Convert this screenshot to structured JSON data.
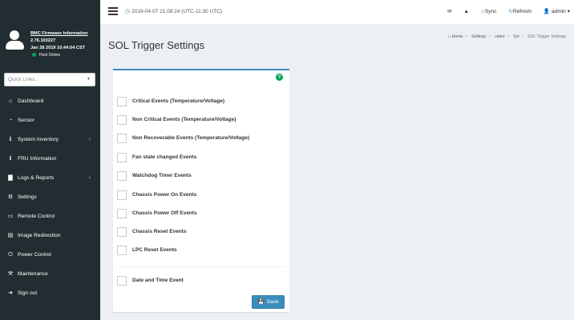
{
  "sidebar": {
    "user": {
      "fw_link": "BMC Firmware Information",
      "version": "2.76.103227",
      "build_date": "Jan 28 2019 10:44:04 CST",
      "status": "Host Online"
    },
    "quicklinks_placeholder": "Quick Links..",
    "items": [
      {
        "label": "Dashboard",
        "icon": "dashboard-icon",
        "glyph": "⌂"
      },
      {
        "label": "Sensor",
        "icon": "sensor-icon",
        "glyph": "◔"
      },
      {
        "label": "System Inventory",
        "icon": "info-icon",
        "glyph": "ℹ",
        "has_submenu": true
      },
      {
        "label": "FRU Information",
        "icon": "info-icon",
        "glyph": "ℹ"
      },
      {
        "label": "Logs & Reports",
        "icon": "chart-icon",
        "glyph": "▇",
        "has_submenu": true
      },
      {
        "label": "Settings",
        "icon": "gear-icon",
        "glyph": "⚙"
      },
      {
        "label": "Remote Control",
        "icon": "monitor-icon",
        "glyph": "▭"
      },
      {
        "label": "Image Redirection",
        "icon": "drive-icon",
        "glyph": "▤"
      },
      {
        "label": "Power Control",
        "icon": "power-icon",
        "glyph": "⏻"
      },
      {
        "label": "Maintenance",
        "icon": "wrench-icon",
        "glyph": "⚒"
      },
      {
        "label": "Sign out",
        "icon": "sign-out-icon",
        "glyph": "➜"
      }
    ]
  },
  "topbar": {
    "datetime": "2019-04-07 21:08:24 (UTC-11:30 UTC)",
    "sync_label": "Sync",
    "refresh_label": "Refresh",
    "user_label": "admin"
  },
  "header": {
    "title": "SOL Trigger Settings",
    "breadcrumb": [
      "Home",
      "Settings",
      "video",
      "Sol",
      "SOL Trigger Settings"
    ]
  },
  "form": {
    "events": [
      "Critical Events (Temperature/Voltage)",
      "Non Critical Events (Temperature/Voltage)",
      "Non Recoverable Events (Temperature/Voltage)",
      "Fan state changed Events",
      "Watchdog Timer Events",
      "Chassis Power On Events",
      "Chassis Power Off Events",
      "Chassis Reset Events",
      "LPC Reset Events"
    ],
    "date_time_event": "Date and Time Event",
    "save_label": "Save"
  },
  "colors": {
    "sidebar_bg": "#222d32",
    "accent": "#3c8dbc",
    "online": "#00a65a",
    "content_bg": "#ecf0f5"
  }
}
